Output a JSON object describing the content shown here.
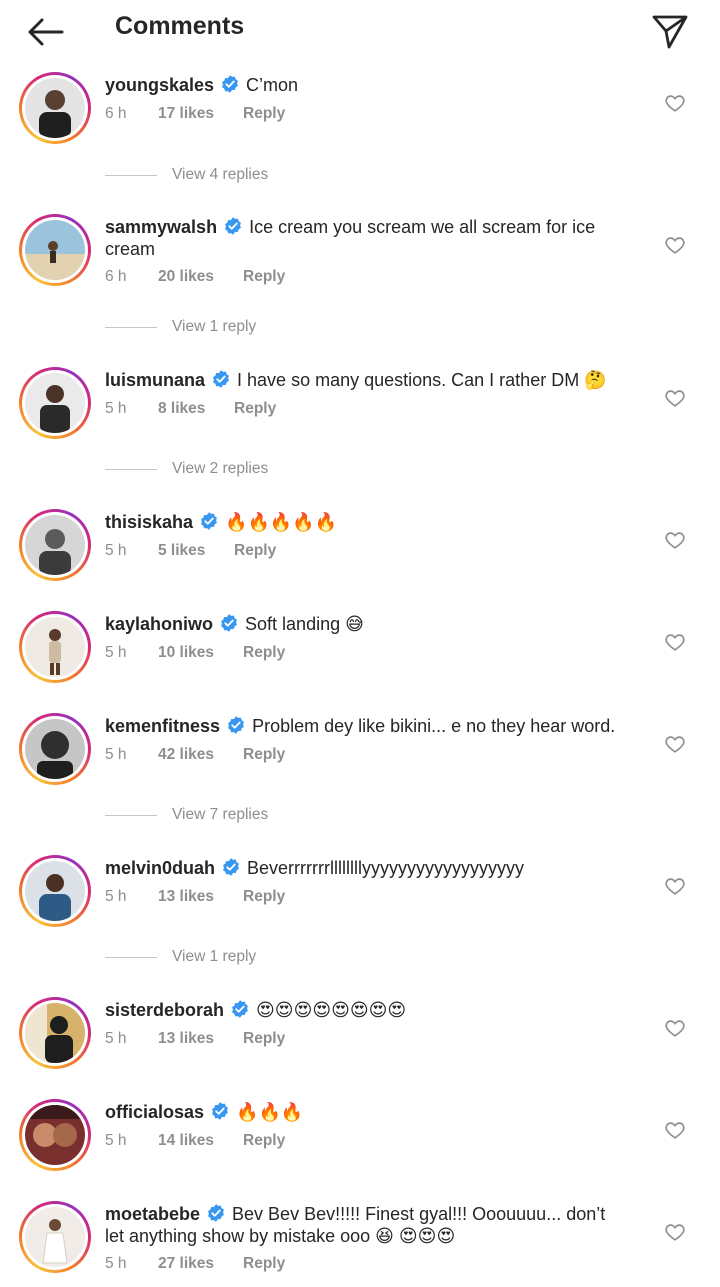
{
  "header": {
    "title": "Comments",
    "back_icon": "arrow-left-icon",
    "send_icon": "paper-plane-icon"
  },
  "comments": [
    {
      "username": "youngskales",
      "text": "C’mon",
      "time": "6 h",
      "likes": "17 likes",
      "reply": "Reply",
      "view_replies": "View 4 replies",
      "avatar_colors": [
        "#2b2b2b",
        "#d9d9d9"
      ]
    },
    {
      "username": "sammywalsh",
      "text": "Ice cream you scream we all scream for ice cream",
      "time": "6 h",
      "likes": "20 likes",
      "reply": "Reply",
      "view_replies": "View 1 reply",
      "avatar_colors": [
        "#8fb7cf",
        "#d8c7a8"
      ]
    },
    {
      "username": "luismunana",
      "text": "I have so many questions. Can I rather DM 🤔",
      "time": "5 h",
      "likes": "8 likes",
      "reply": "Reply",
      "view_replies": "View 2 replies",
      "avatar_colors": [
        "#3a3a3a",
        "#e6e6e6"
      ]
    },
    {
      "username": "thisiskaha",
      "text": "🔥🔥🔥🔥🔥",
      "time": "5 h",
      "likes": "5 likes",
      "reply": "Reply",
      "view_replies": "",
      "avatar_colors": [
        "#5a5a5a",
        "#cfcfcf"
      ]
    },
    {
      "username": "kaylahoniwo",
      "text": "Soft landing 😅",
      "time": "5 h",
      "likes": "10 likes",
      "reply": "Reply",
      "view_replies": "",
      "avatar_colors": [
        "#c9b49a",
        "#f1ece6"
      ]
    },
    {
      "username": "kemenfitness",
      "text": "Problem dey like bikini... e no they hear word.",
      "time": "5 h",
      "likes": "42 likes",
      "reply": "Reply",
      "view_replies": "View 7 replies",
      "avatar_colors": [
        "#2f2f2f",
        "#bdbdbd"
      ]
    },
    {
      "username": "melvin0duah",
      "text": "Beverrrrrrrllllllllyyyyyyyyyyyyyyyyyy",
      "time": "5 h",
      "likes": "13 likes",
      "reply": "Reply",
      "view_replies": "View 1 reply",
      "avatar_colors": [
        "#2e5a86",
        "#d8dde2"
      ]
    },
    {
      "username": "sisterdeborah",
      "text": "😍😍😍😍😍😍😍😍",
      "time": "5 h",
      "likes": "13 likes",
      "reply": "Reply",
      "view_replies": "",
      "avatar_colors": [
        "#1e1e1e",
        "#d7b26a"
      ]
    },
    {
      "username": "officialosas",
      "text": "🔥🔥🔥",
      "time": "5 h",
      "likes": "14 likes",
      "reply": "Reply",
      "view_replies": "",
      "avatar_colors": [
        "#6b2a2a",
        "#c98c6a"
      ]
    },
    {
      "username": "moetabebe",
      "text": "Bev Bev Bev!!!!! Finest gyal!!! Ooouuuu... don’t let anything show by mistake ooo 😆 😍😍😍",
      "time": "5 h",
      "likes": "27 likes",
      "reply": "Reply",
      "view_replies": "",
      "avatar_colors": [
        "#e8e2dc",
        "#ffffff"
      ]
    }
  ],
  "icons": {
    "verified": "verified-badge-icon",
    "heart": "heart-outline-icon"
  },
  "colors": {
    "verified": "#3897f0",
    "muted": "#8e8e8e",
    "text": "#262626"
  }
}
